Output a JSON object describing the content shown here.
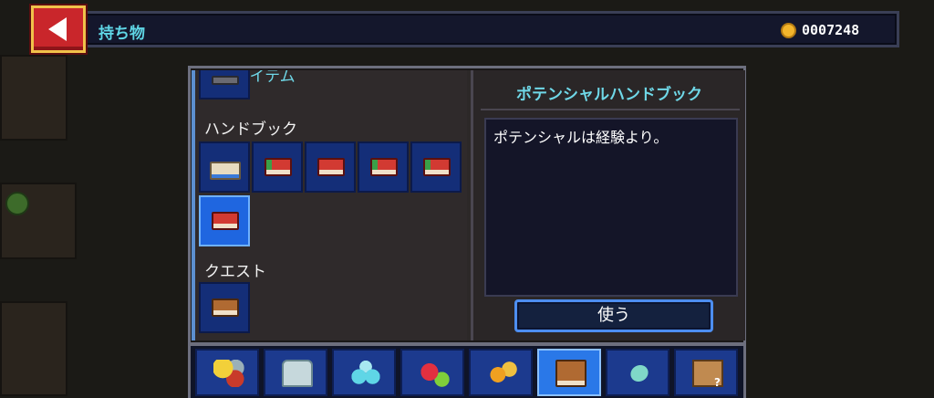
{
  "header": {
    "title": "持ち物",
    "coins": "0007248"
  },
  "inventory": {
    "sections": [
      {
        "label": "キーアイテム",
        "item_count": 1
      },
      {
        "label": "ハンドブック",
        "item_count": 6
      },
      {
        "label": "クエスト",
        "item_count": 1
      }
    ]
  },
  "detail": {
    "title": "ポテンシャルハンドブック",
    "description": "ポテンシャルは経験より。",
    "use_label": "使う"
  },
  "tabs": [
    {
      "icon": "food-icon",
      "selected": false
    },
    {
      "icon": "armor-icon",
      "selected": false
    },
    {
      "icon": "orbs-icon",
      "selected": false
    },
    {
      "icon": "heart-fruit-icon",
      "selected": false
    },
    {
      "icon": "potion-icon",
      "selected": false
    },
    {
      "icon": "book-icon",
      "selected": true
    },
    {
      "icon": "gem-icon",
      "selected": false
    },
    {
      "icon": "mystery-box-icon",
      "selected": false
    }
  ],
  "colors": {
    "accent_cyan": "#5fd6e6",
    "slot_blue": "#142e78",
    "slot_selected": "#1f66e0",
    "back_red": "#c9262b"
  }
}
